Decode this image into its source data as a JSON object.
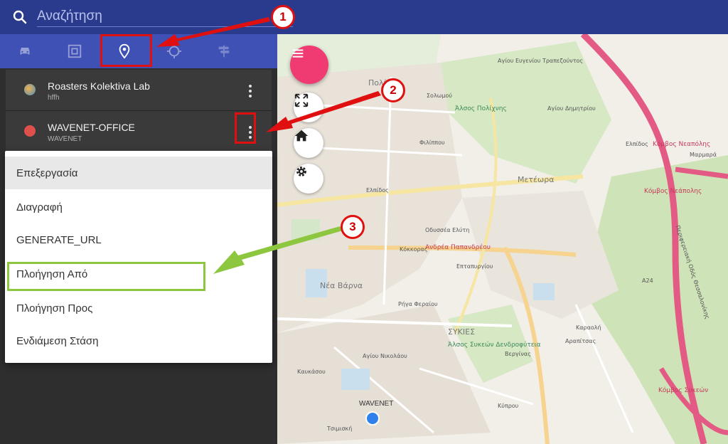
{
  "search": {
    "placeholder": "Αναζήτηση"
  },
  "tabs": [
    {
      "icon": "car-icon"
    },
    {
      "icon": "geofence-icon"
    },
    {
      "icon": "place-marker-icon",
      "selected": true
    },
    {
      "icon": "crosshair-icon"
    },
    {
      "icon": "signpost-icon"
    }
  ],
  "places": [
    {
      "title": "Roasters Kolektiva Lab",
      "subtitle": "hffh",
      "icon_color": "#e08a3c"
    },
    {
      "title": "WAVENET-OFFICE",
      "subtitle": "WAVENET",
      "icon_color": "#e0504a"
    }
  ],
  "context_menu": [
    {
      "label": "Επεξεργασία"
    },
    {
      "label": "Διαγραφή"
    },
    {
      "label": "GENERATE_URL"
    },
    {
      "label": "Πλοήγηση Από"
    },
    {
      "label": "Πλοήγηση Προς"
    },
    {
      "label": "Ενδιάμεση Στάση"
    }
  ],
  "map": {
    "marker_label": "WAVENET",
    "labels": [
      {
        "text": "Πολίχνη",
        "cls": "big"
      },
      {
        "text": "Μετέωρα",
        "cls": "big"
      },
      {
        "text": "Νέα Βάρνα",
        "cls": "big"
      },
      {
        "text": "ΣΥΚΙΕΣ",
        "cls": "big"
      },
      {
        "text": "Άλσος Πολίχνης",
        "cls": "green"
      },
      {
        "text": "Άλσος Συκεών Δενδροφύτεια",
        "cls": "green"
      },
      {
        "text": "Κόμβος Νεαπόλης",
        "cls": "red"
      },
      {
        "text": "Κόμβος Νεάπολης",
        "cls": "red"
      },
      {
        "text": "Κόμβος Συκεών",
        "cls": "red"
      },
      {
        "text": "Ανδρέα Παπανδρέου",
        "cls": "red"
      },
      {
        "text": "Περιφερειακή Οδός Θεσσαλονίκης",
        "cls": ""
      },
      {
        "text": "Ελπίδος",
        "cls": ""
      },
      {
        "text": "Κόκκορας",
        "cls": ""
      },
      {
        "text": "Επταπυργίου",
        "cls": ""
      },
      {
        "text": "Ρήγα Φεραίου",
        "cls": ""
      },
      {
        "text": "Οδυσσέα Ελύτη",
        "cls": ""
      },
      {
        "text": "Σολωμού",
        "cls": ""
      },
      {
        "text": "Φιλίππου",
        "cls": ""
      },
      {
        "text": "Καυκάσου",
        "cls": ""
      },
      {
        "text": "Τσιμισκή",
        "cls": ""
      },
      {
        "text": "Α24",
        "cls": ""
      },
      {
        "text": "Αγίου Ευγενίου Τραπεζούντος",
        "cls": ""
      },
      {
        "text": "Ελπίδος",
        "cls": ""
      },
      {
        "text": "Μαρμαρά",
        "cls": ""
      },
      {
        "text": "Αγίου Δημητρίου",
        "cls": ""
      },
      {
        "text": "Καραολή",
        "cls": ""
      },
      {
        "text": "Αραπίτσας",
        "cls": ""
      },
      {
        "text": "Αγίου Νικολάου",
        "cls": ""
      },
      {
        "text": "Κύπρου",
        "cls": ""
      },
      {
        "text": "Βεργίνας",
        "cls": ""
      }
    ]
  },
  "annotations": [
    {
      "number": "1"
    },
    {
      "number": "2"
    },
    {
      "number": "3"
    }
  ],
  "colors": {
    "topbar": "#2a3a8c",
    "tabbar": "#3f51b5",
    "fab": "#ef3b72",
    "annotation_red": "#e01010",
    "annotation_green": "#8dc63f"
  }
}
